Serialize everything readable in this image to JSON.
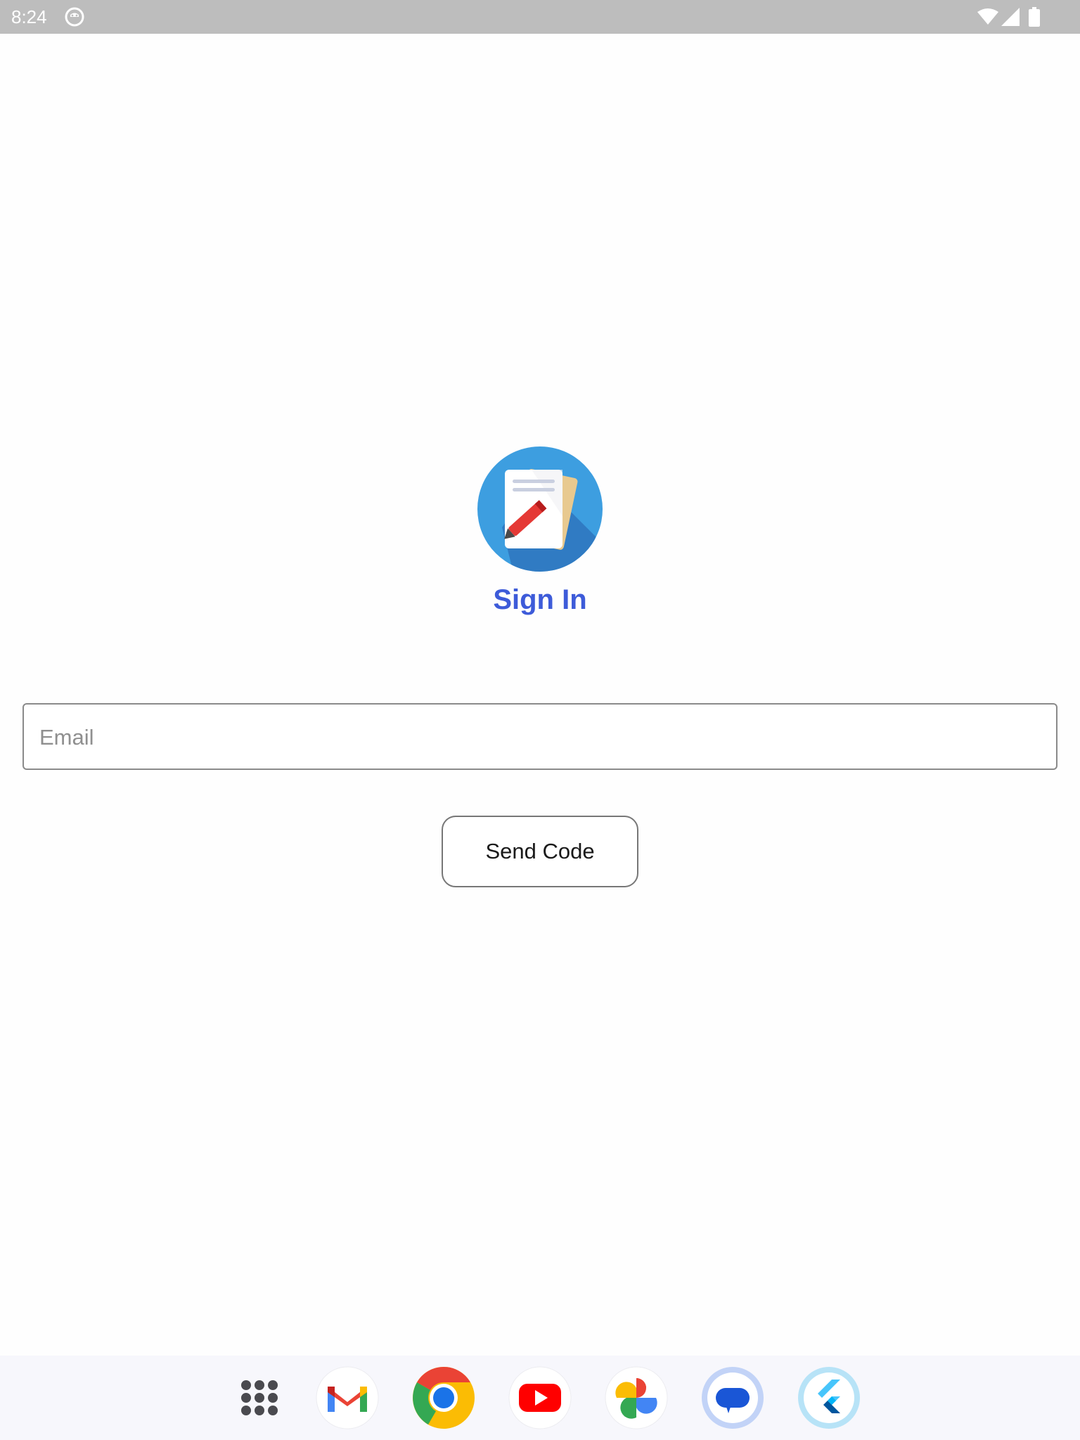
{
  "status_bar": {
    "time": "8:24",
    "icons": [
      "app-notification-icon",
      "wifi-icon",
      "signal-icon",
      "battery-icon"
    ]
  },
  "app": {
    "logo_icon": "notes-pencil-logo",
    "title": "Sign In",
    "title_color": "#3d5bd9"
  },
  "form": {
    "email_placeholder": "Email",
    "email_value": "",
    "send_button_label": "Send Code"
  },
  "dock": {
    "apps": [
      "apps-grid-icon",
      "gmail-icon",
      "chrome-icon",
      "youtube-icon",
      "photos-icon",
      "messages-icon",
      "flutter-icon"
    ]
  }
}
